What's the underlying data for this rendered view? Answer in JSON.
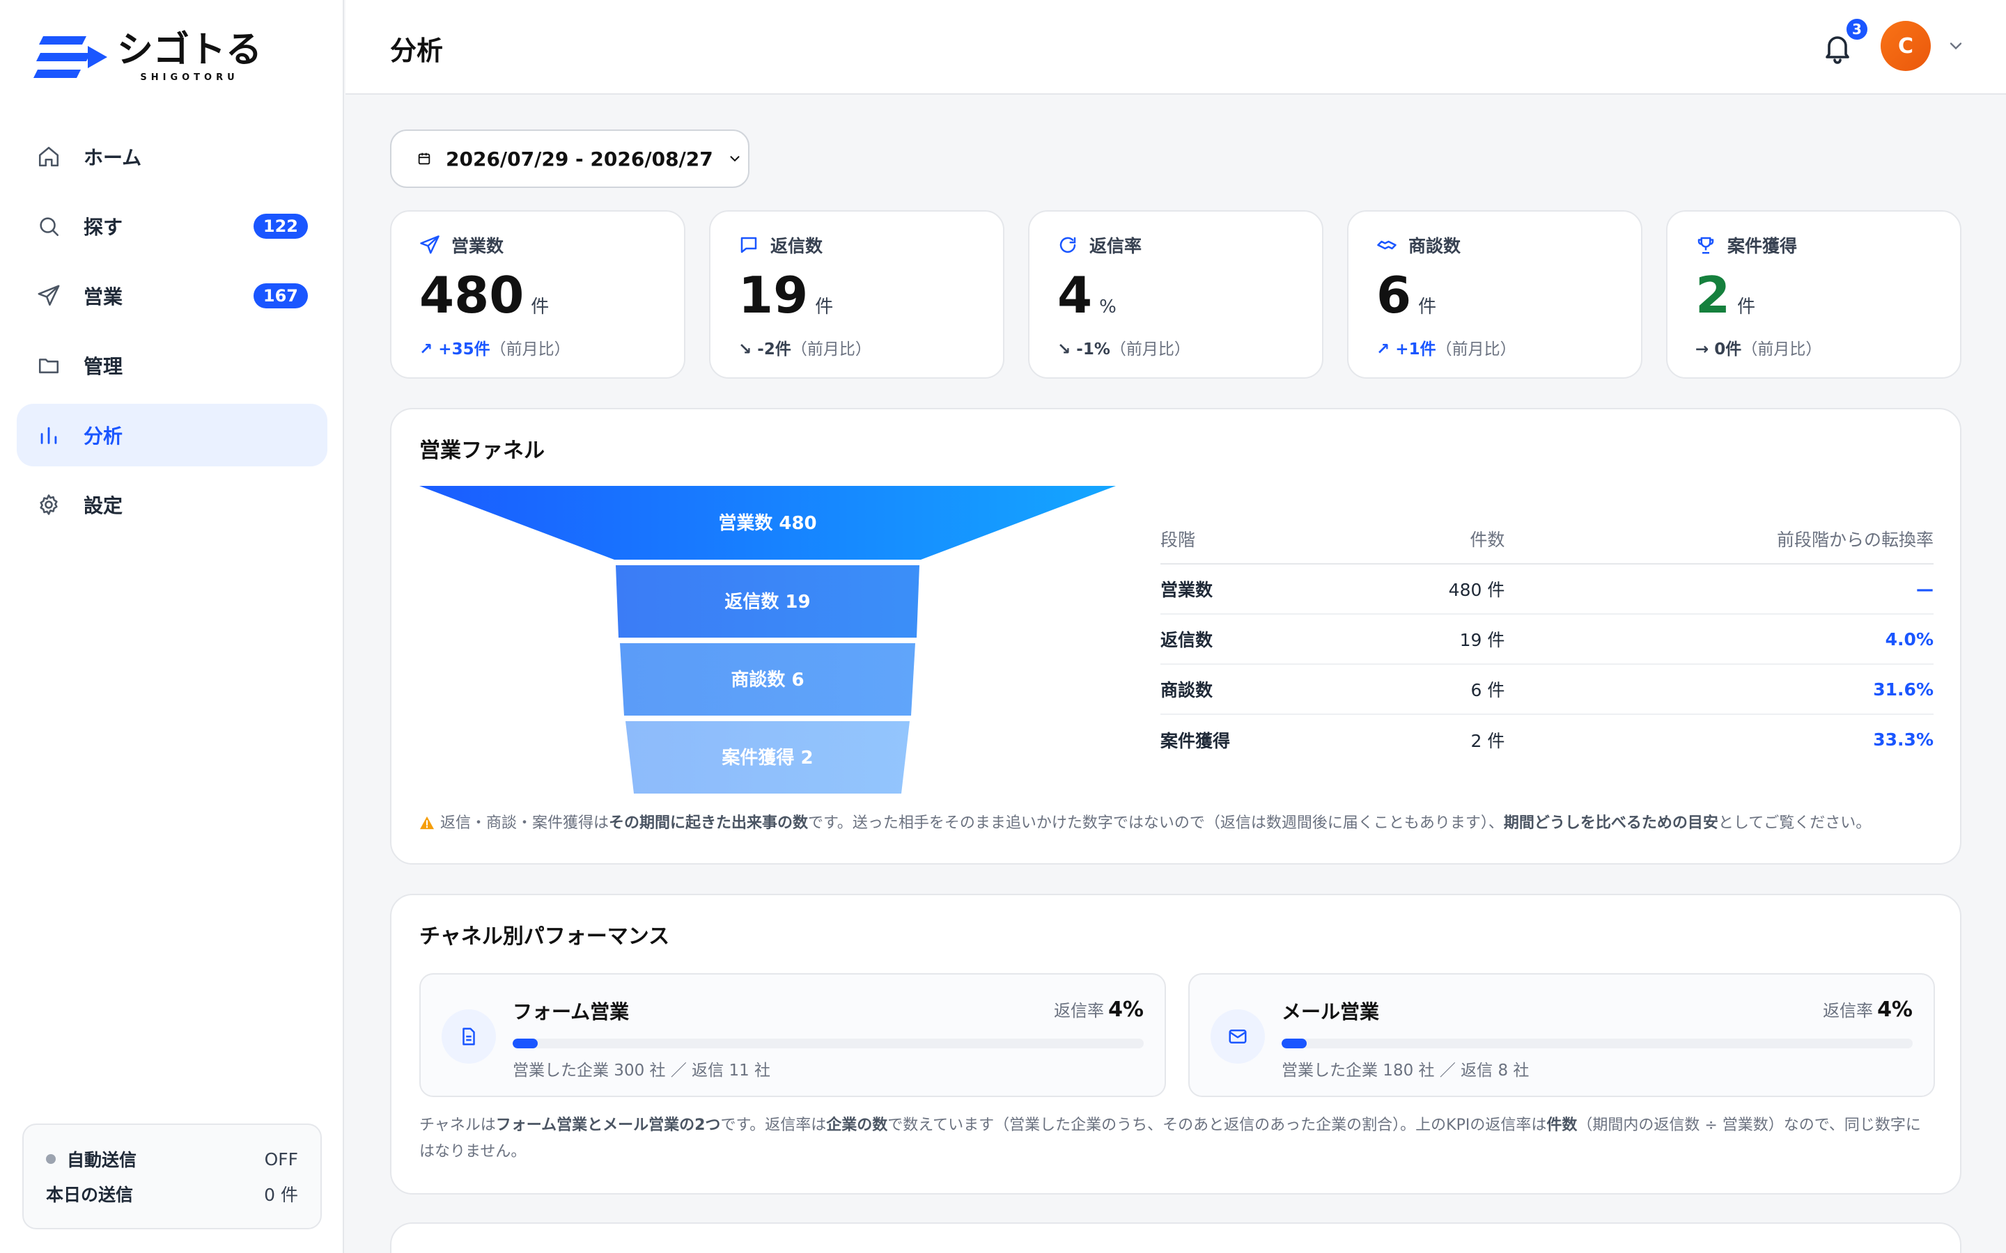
{
  "app": {
    "logo_text": "シゴトる",
    "logo_sub": "SHIGOTORU"
  },
  "sidebar": {
    "items": [
      {
        "label": "ホーム",
        "icon": "home-icon",
        "badge": null,
        "active": false
      },
      {
        "label": "探す",
        "icon": "search-icon",
        "badge": "122",
        "active": false
      },
      {
        "label": "営業",
        "icon": "send-icon",
        "badge": "167",
        "active": false
      },
      {
        "label": "管理",
        "icon": "folder-icon",
        "badge": null,
        "active": false
      },
      {
        "label": "分析",
        "icon": "bar-chart-icon",
        "badge": null,
        "active": true
      },
      {
        "label": "設定",
        "icon": "gear-icon",
        "badge": null,
        "active": false
      }
    ],
    "auto_send": {
      "label": "自動送信",
      "status": "OFF",
      "today_label": "本日の送信",
      "today_value": "0 件"
    }
  },
  "header": {
    "title": "分析",
    "notification_count": "3",
    "avatar_initial": "C"
  },
  "date_range": {
    "label": "2026/07/29 - 2026/08/27"
  },
  "kpis": [
    {
      "label": "営業数",
      "value": "480",
      "unit": "件",
      "delta": "+35件",
      "trend": "up",
      "arrow": "↗",
      "compare": "（前月比）",
      "icon": "send-icon"
    },
    {
      "label": "返信数",
      "value": "19",
      "unit": "件",
      "delta": "-2件",
      "trend": "down",
      "arrow": "↘",
      "compare": "（前月比）",
      "icon": "chat-icon"
    },
    {
      "label": "返信率",
      "value": "4",
      "unit": "%",
      "delta": "-1%",
      "trend": "down",
      "arrow": "↘",
      "compare": "（前月比）",
      "icon": "refresh-icon"
    },
    {
      "label": "商談数",
      "value": "6",
      "unit": "件",
      "delta": "+1件",
      "trend": "up",
      "arrow": "↗",
      "compare": "（前月比）",
      "icon": "handshake-icon"
    },
    {
      "label": "案件獲得",
      "value": "2",
      "unit": "件",
      "delta": "0件",
      "trend": "flat",
      "arrow": "→",
      "compare": "（前月比）",
      "icon": "trophy-icon"
    }
  ],
  "funnel": {
    "title": "営業ファネル",
    "stages": [
      {
        "label": "営業数 480",
        "color": "#1a56ff"
      },
      {
        "label": "返信数 19",
        "color": "#3b82f6"
      },
      {
        "label": "商談数 6",
        "color": "#5b9cf8"
      },
      {
        "label": "案件獲得 2",
        "color": "#93c5fd"
      }
    ],
    "table": {
      "headers": [
        "段階",
        "件数",
        "前段階からの転換率"
      ],
      "rows": [
        [
          "営業数",
          "480 件",
          "—"
        ],
        [
          "返信数",
          "19 件",
          "4.0%"
        ],
        [
          "商談数",
          "6 件",
          "31.6%"
        ],
        [
          "案件獲得",
          "2 件",
          "33.3%"
        ]
      ]
    },
    "note_pre": "返信・商談・案件獲得は",
    "note_b1": "その期間に起きた出来事の数",
    "note_mid": "です。送った相手をそのまま追いかけた数字ではないので（返信は数週間後に届くこともあります）、",
    "note_b2": "期間どうしを比べるための目安",
    "note_post": "としてご覧ください。"
  },
  "channels": {
    "title": "チャネル別パフォーマンス",
    "items": [
      {
        "name": "フォーム営業",
        "rate_label": "返信率",
        "rate": "4%",
        "rate_value": 0.04,
        "sub": "営業した企業 300 社 ／ 返信 11 社",
        "icon": "document-icon"
      },
      {
        "name": "メール営業",
        "rate_label": "返信率",
        "rate": "4%",
        "rate_value": 0.04,
        "sub": "営業した企業 180 社 ／ 返信 8 社",
        "icon": "mail-icon"
      }
    ],
    "note_pre": "チャネルは",
    "note_b1": "フォーム営業とメール営業の2つ",
    "note_mid1": "です。返信率は",
    "note_b2": "企業の数",
    "note_mid2": "で数えています（営業した企業のうち、そのあと返信のあった企業の割合）。上のKPIの返信率は",
    "note_b3": "件数",
    "note_post": "（期間内の返信数 ÷ 営業数）なので、同じ数字にはなりません。"
  }
}
